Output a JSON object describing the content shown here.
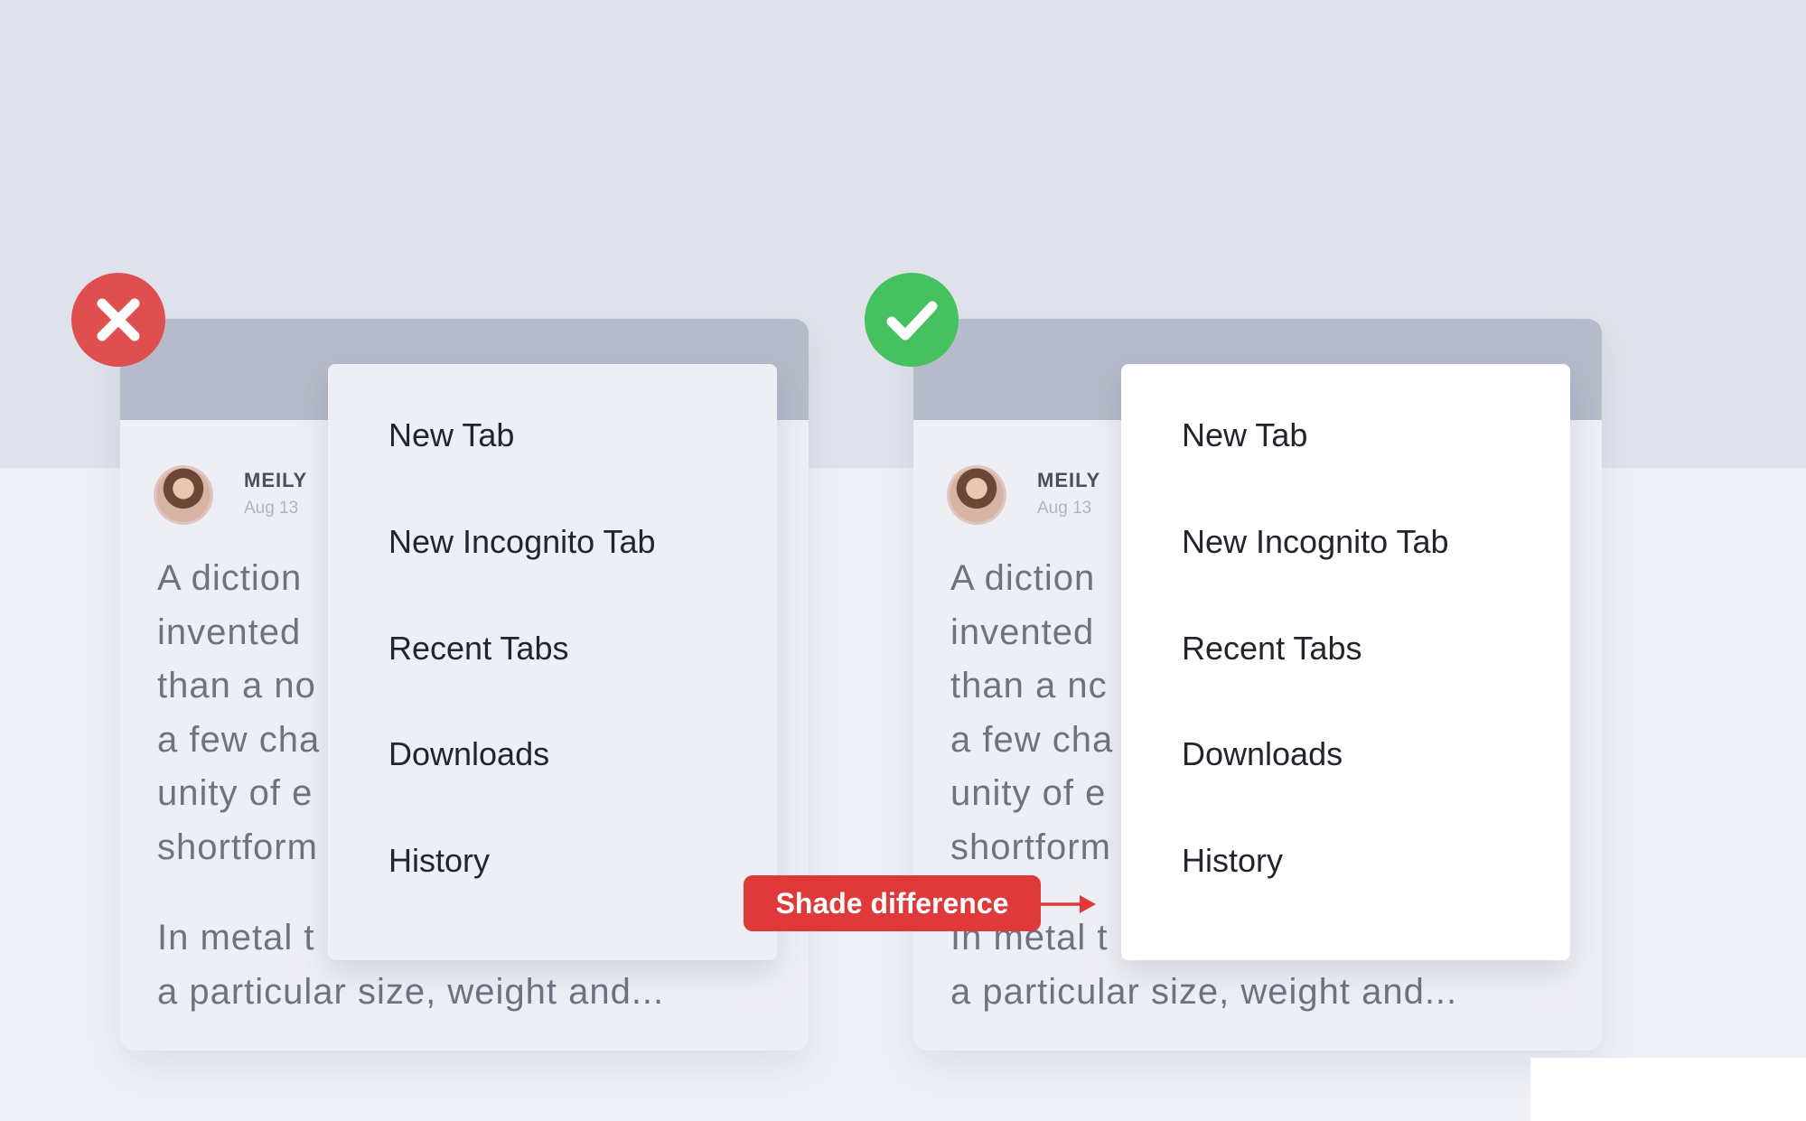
{
  "colors": {
    "error": "#e04f4f",
    "success": "#45c15f",
    "callout": "#e0393a",
    "menu_dim": "#eeeff5",
    "menu_white": "#ffffff"
  },
  "panels": [
    {
      "variant": "incorrect",
      "badge_icon": "close-icon",
      "author": "MEILY",
      "date": "Aug 13",
      "paragraph1": [
        "A diction",
        "invented",
        "than a no",
        "a few cha",
        "unity of e",
        "shortform"
      ],
      "paragraph2": [
        "In metal t",
        "a particular size, weight and..."
      ],
      "menu": [
        "New Tab",
        "New Incognito Tab",
        "Recent Tabs",
        "Downloads",
        "History"
      ]
    },
    {
      "variant": "correct",
      "badge_icon": "check-icon",
      "author": "MEILY",
      "date": "Aug 13",
      "paragraph1": [
        "A diction",
        "invented",
        "than a nc",
        "a few cha",
        "unity of e",
        "shortform"
      ],
      "paragraph2": [
        "In metal t",
        "a particular size, weight and..."
      ],
      "menu": [
        "New Tab",
        "New Incognito Tab",
        "Recent Tabs",
        "Downloads",
        "History"
      ]
    }
  ],
  "callout": {
    "label": "Shade difference"
  }
}
